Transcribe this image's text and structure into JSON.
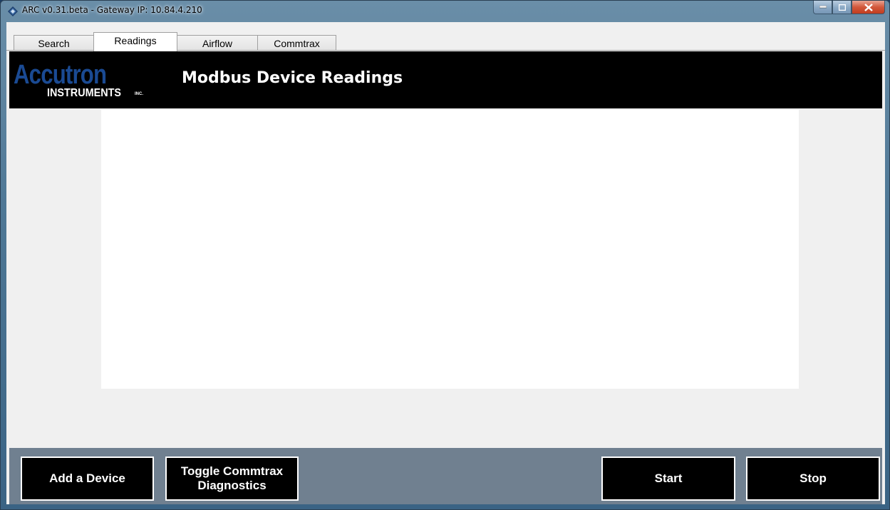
{
  "window": {
    "title": "ARC v0.31.beta - Gateway IP: 10.84.4.210"
  },
  "tabs": [
    {
      "label": "Search",
      "active": false
    },
    {
      "label": "Readings",
      "active": true
    },
    {
      "label": "Airflow",
      "active": false
    },
    {
      "label": "Commtrax",
      "active": false
    }
  ],
  "header": {
    "logo_main": "Accutron",
    "logo_sub": "INSTRUMENTS",
    "logo_inc": "INC.",
    "title": "Modbus Device Readings"
  },
  "buttons": {
    "add_device": "Add a Device",
    "toggle_diag_line1": "Toggle Commtrax",
    "toggle_diag_line2": "Diagnostics",
    "start": "Start",
    "stop": "Stop"
  },
  "colors": {
    "header_bg": "#000000",
    "logo_blue": "#1a4a93",
    "bottom_bar": "#708090",
    "button_bg": "#000000"
  }
}
